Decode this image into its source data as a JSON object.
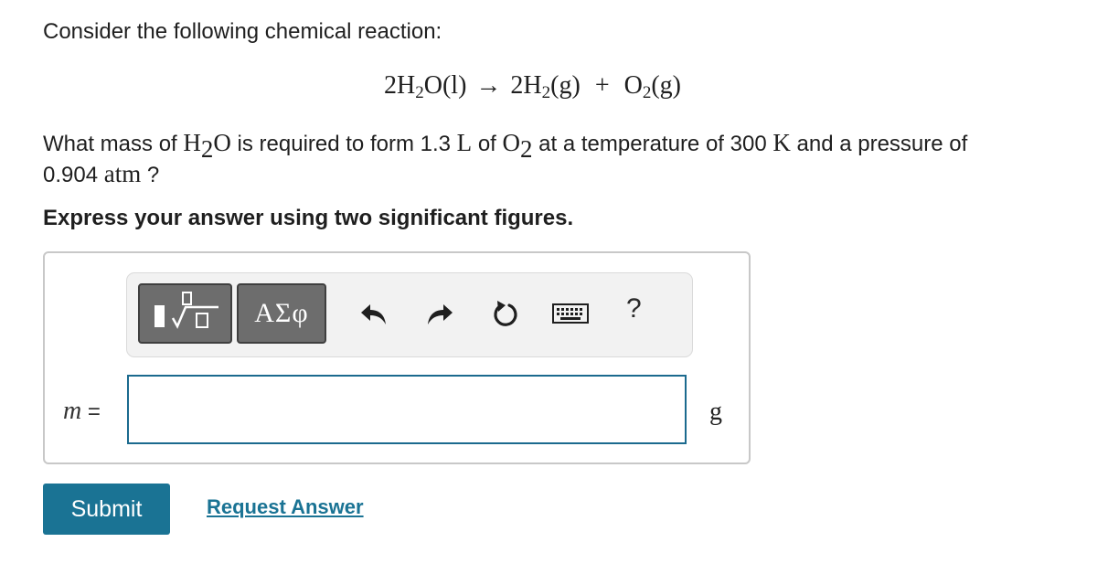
{
  "problem": {
    "intro": "Consider the following chemical reaction:",
    "equation": {
      "reactant_coef": "2",
      "reactant_h": "H",
      "reactant_h_sub": "2",
      "reactant_o": "O(l)",
      "arrow": "→",
      "product1_coef": "2",
      "product1_h": "H",
      "product1_h_sub": "2",
      "product1_state": "(g)",
      "plus": "+",
      "product2_o": "O",
      "product2_o_sub": "2",
      "product2_state": "(g)"
    },
    "question": {
      "part1": "What mass of ",
      "h2o_h": "H",
      "h2o_sub": "2",
      "h2o_o": "O",
      "part2": " is required to form 1.3 ",
      "unit_L": "L",
      "part3": " of ",
      "o2_o": "O",
      "o2_sub": "2",
      "part4": " at a temperature of 300 ",
      "unit_K": "K",
      "part5": " and a pressure of",
      "pressure_value": "0.904",
      "unit_atm": "atm",
      "end": " ?"
    },
    "instruction": "Express your answer using two significant figures."
  },
  "toolbar": {
    "greek_label": "ΑΣφ",
    "help_label": "?",
    "icons": [
      "templates-icon",
      "greek-symbols-icon",
      "undo-icon",
      "redo-icon",
      "reset-icon",
      "keyboard-icon",
      "help-icon"
    ]
  },
  "answer": {
    "variable": "m",
    "equals": "=",
    "value": "",
    "unit": "g"
  },
  "actions": {
    "submit_label": "Submit",
    "request_label": "Request Answer"
  },
  "colors": {
    "accent": "#1a7394",
    "input_border": "#1b6a8e",
    "toolbar_button": "#6d6d6d",
    "toolbar_bg": "#f2f2f2"
  }
}
